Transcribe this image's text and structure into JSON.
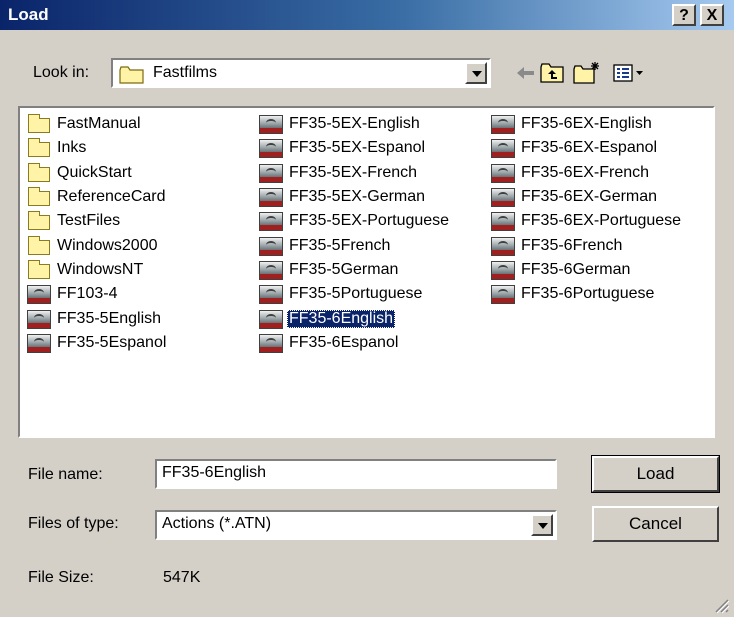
{
  "window": {
    "title": "Load",
    "help_label": "?",
    "close_label": "X"
  },
  "lookin": {
    "label": "Look in:",
    "value": "Fastfilms"
  },
  "toolbar": {
    "back_icon": "back-arrow-icon",
    "up_icon": "up-one-level-icon",
    "newfolder_icon": "new-folder-icon",
    "view_icon": "view-menu-icon"
  },
  "files": {
    "col1": [
      {
        "label": "FastManual",
        "type": "folder"
      },
      {
        "label": "Inks",
        "type": "folder"
      },
      {
        "label": "QuickStart",
        "type": "folder"
      },
      {
        "label": "ReferenceCard",
        "type": "folder"
      },
      {
        "label": "TestFiles",
        "type": "folder"
      },
      {
        "label": "Windows2000",
        "type": "folder"
      },
      {
        "label": "WindowsNT",
        "type": "folder"
      },
      {
        "label": "FF103-4",
        "type": "action"
      },
      {
        "label": "FF35-5English",
        "type": "action"
      },
      {
        "label": "FF35-5Espanol",
        "type": "action"
      }
    ],
    "col2": [
      {
        "label": "FF35-5EX-English",
        "type": "action"
      },
      {
        "label": "FF35-5EX-Espanol",
        "type": "action"
      },
      {
        "label": "FF35-5EX-French",
        "type": "action"
      },
      {
        "label": "FF35-5EX-German",
        "type": "action"
      },
      {
        "label": "FF35-5EX-Portuguese",
        "type": "action"
      },
      {
        "label": "FF35-5French",
        "type": "action"
      },
      {
        "label": "FF35-5German",
        "type": "action"
      },
      {
        "label": "FF35-5Portuguese",
        "type": "action"
      },
      {
        "label": "FF35-6English",
        "type": "action"
      },
      {
        "label": "FF35-6Espanol",
        "type": "action"
      }
    ],
    "col3": [
      {
        "label": "FF35-6EX-English",
        "type": "action"
      },
      {
        "label": "FF35-6EX-Espanol",
        "type": "action"
      },
      {
        "label": "FF35-6EX-French",
        "type": "action"
      },
      {
        "label": "FF35-6EX-German",
        "type": "action"
      },
      {
        "label": "FF35-6EX-Portuguese",
        "type": "action"
      },
      {
        "label": "FF35-6French",
        "type": "action"
      },
      {
        "label": "FF35-6German",
        "type": "action"
      },
      {
        "label": "FF35-6Portuguese",
        "type": "action"
      }
    ],
    "selected": "FF35-6English"
  },
  "filename": {
    "label": "File name:",
    "value": "FF35-6English"
  },
  "filetype": {
    "label": "Files of type:",
    "value": "Actions (*.ATN)"
  },
  "filesize": {
    "label": "File Size:",
    "value": "547K"
  },
  "buttons": {
    "load": "Load",
    "cancel": "Cancel"
  }
}
